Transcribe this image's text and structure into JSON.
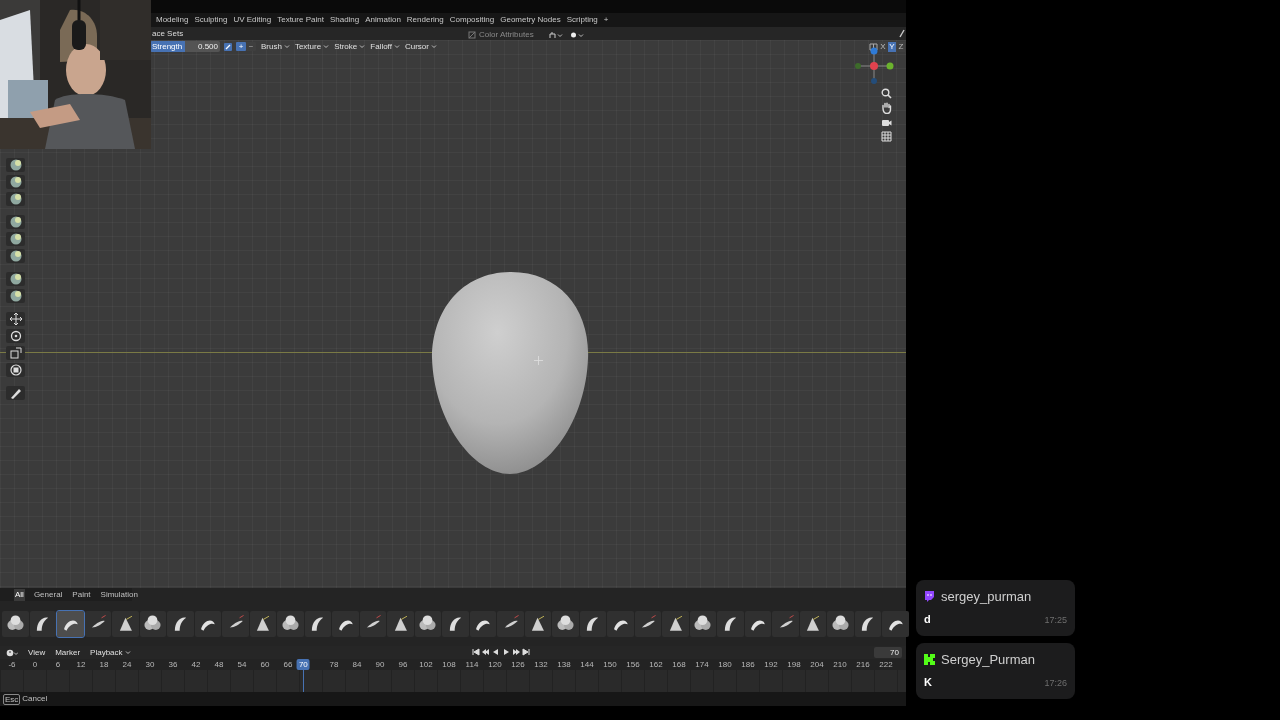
{
  "workspace_tabs": [
    "Modeling",
    "Sculpting",
    "UV Editing",
    "Texture Paint",
    "Shading",
    "Animation",
    "Rendering",
    "Compositing",
    "Geometry Nodes",
    "Scripting",
    "+"
  ],
  "header": {
    "mode_label": "ace Sets",
    "color_attributes": {
      "label": "Color Attributes",
      "disabled": true
    }
  },
  "tool_header": {
    "strength": {
      "label": "Strength",
      "value": "0.500",
      "level": 0.5
    },
    "direction": [
      {
        "label": "+",
        "selected": true
      },
      {
        "label": "−",
        "selected": false
      }
    ],
    "menus": [
      "Brush",
      "Texture",
      "Stroke",
      "Falloff",
      "Cursor"
    ],
    "mirror_axes": [
      {
        "label": "X",
        "selected": false
      },
      {
        "label": "Y",
        "selected": true
      },
      {
        "label": "Z",
        "selected": false
      }
    ]
  },
  "toolbar": [
    {
      "kind": "brush"
    },
    {
      "kind": "brush"
    },
    {
      "kind": "brush"
    },
    {
      "kind": "gap"
    },
    {
      "kind": "brush"
    },
    {
      "kind": "brush"
    },
    {
      "kind": "brush"
    },
    {
      "kind": "gap"
    },
    {
      "kind": "brush"
    },
    {
      "kind": "brush"
    },
    {
      "kind": "gap"
    },
    {
      "kind": "move"
    },
    {
      "kind": "rotate"
    },
    {
      "kind": "scale"
    },
    {
      "kind": "transform"
    },
    {
      "kind": "gap"
    },
    {
      "kind": "annotate"
    }
  ],
  "asset_shelf": {
    "tabs": [
      {
        "label": "All",
        "selected": true
      },
      {
        "label": "General",
        "selected": false
      },
      {
        "label": "Paint",
        "selected": false
      },
      {
        "label": "Simulation",
        "selected": false
      }
    ],
    "brushes": [
      {
        "selected": false
      },
      {
        "selected": false
      },
      {
        "selected": true
      },
      {
        "selected": false
      },
      {
        "selected": false
      },
      {
        "selected": false
      },
      {
        "selected": false
      },
      {
        "selected": false
      },
      {
        "selected": false
      },
      {
        "selected": false
      },
      {
        "selected": false
      },
      {
        "selected": false
      },
      {
        "selected": false
      },
      {
        "selected": false
      },
      {
        "selected": false
      },
      {
        "selected": false
      },
      {
        "selected": false
      },
      {
        "selected": false
      },
      {
        "selected": false
      },
      {
        "selected": false
      },
      {
        "selected": false
      },
      {
        "selected": false
      },
      {
        "selected": false
      },
      {
        "selected": false
      },
      {
        "selected": false
      },
      {
        "selected": false
      },
      {
        "selected": false
      },
      {
        "selected": false
      },
      {
        "selected": false
      },
      {
        "selected": false
      },
      {
        "selected": false
      },
      {
        "selected": false
      },
      {
        "selected": false
      }
    ]
  },
  "timeline": {
    "menus": [
      "View",
      "Marker",
      "Playback"
    ],
    "current_frame": "70",
    "frame_field": "70",
    "ticks": [
      "-6",
      "0",
      "6",
      "12",
      "18",
      "24",
      "30",
      "36",
      "42",
      "48",
      "54",
      "60",
      "66",
      "78",
      "84",
      "90",
      "96",
      "102",
      "108",
      "114",
      "120",
      "126",
      "132",
      "138",
      "144",
      "150",
      "156",
      "162",
      "168",
      "174",
      "180",
      "186",
      "192",
      "198",
      "204",
      "210",
      "216",
      "222"
    ]
  },
  "status_bar": {
    "key": "Esc",
    "action": "Cancel"
  },
  "chat": [
    {
      "kind": "twitch",
      "user": "sergey_purman",
      "message": "d",
      "time": "17:25"
    },
    {
      "kind": "kick",
      "user": "Sergey_Purman",
      "message": "K",
      "time": "17:26"
    }
  ]
}
